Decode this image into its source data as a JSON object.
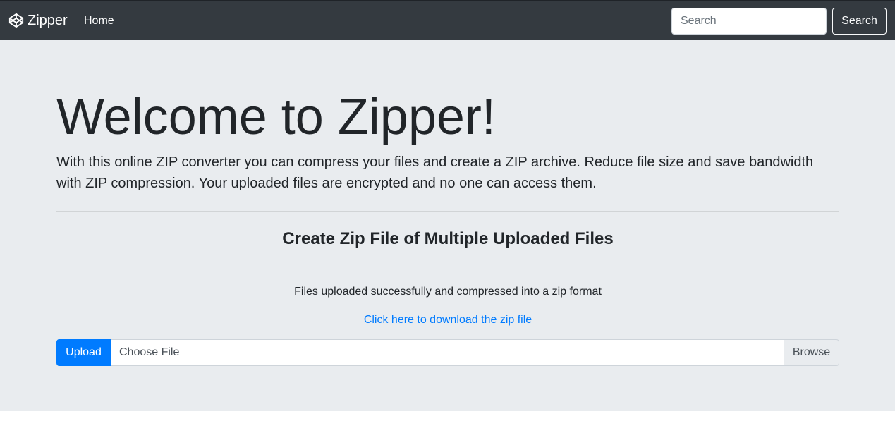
{
  "navbar": {
    "brand_label": "Zipper",
    "brand_icon": "codepen-icon",
    "home_label": "Home",
    "search": {
      "placeholder": "Search",
      "value": ""
    },
    "search_button_label": "Search"
  },
  "hero": {
    "title": "Welcome to Zipper!",
    "lead": "With this online ZIP converter you can compress your files and create a ZIP archive. Reduce file size and save bandwidth with ZIP compression. Your uploaded files are encrypted and no one can access them."
  },
  "upload_section": {
    "heading": "Create Zip File of Multiple Uploaded Files",
    "status_message": "Files uploaded successfully and compressed into a zip format",
    "download_link_label": "Click here to download the zip file",
    "upload_label": "Upload",
    "file_placeholder": "Choose File",
    "browse_label": "Browse"
  },
  "colors": {
    "navbar_bg": "#343a40",
    "jumbotron_bg": "#e9ecef",
    "accent": "#007bff",
    "text": "#212529"
  }
}
